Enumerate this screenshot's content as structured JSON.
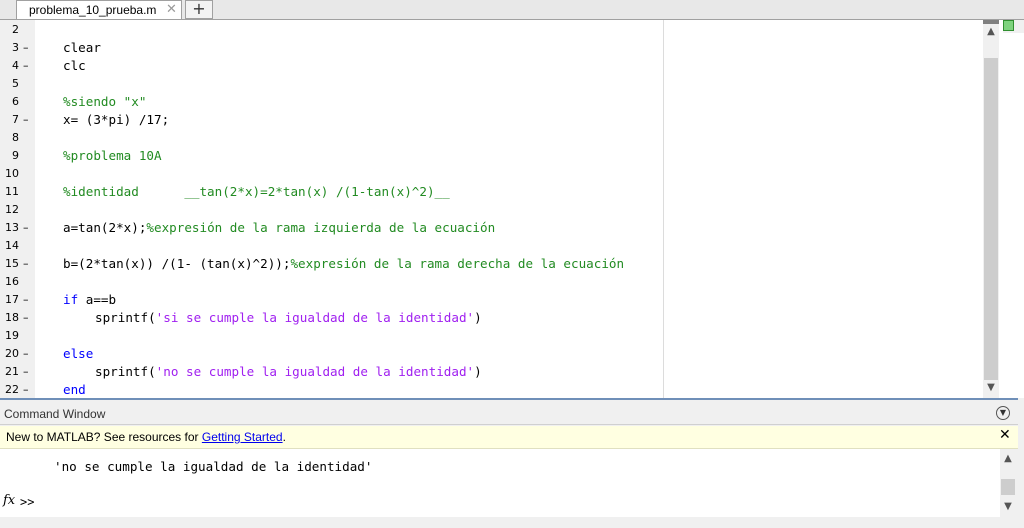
{
  "tab": {
    "title": "problema_10_prueba.m",
    "close": "✕",
    "add": "+"
  },
  "editor": {
    "lines": [
      {
        "n": "2",
        "dash": false,
        "indent": false,
        "parts": []
      },
      {
        "n": "3",
        "dash": true,
        "indent": false,
        "parts": [
          {
            "t": "clear",
            "c": "tx"
          }
        ]
      },
      {
        "n": "4",
        "dash": true,
        "indent": false,
        "parts": [
          {
            "t": "clc",
            "c": "tx"
          }
        ]
      },
      {
        "n": "5",
        "dash": false,
        "indent": false,
        "parts": []
      },
      {
        "n": "6",
        "dash": false,
        "indent": false,
        "parts": [
          {
            "t": "%siendo \"x\"",
            "c": "cm"
          }
        ]
      },
      {
        "n": "7",
        "dash": true,
        "indent": false,
        "parts": [
          {
            "t": "x= (3*pi) /17;",
            "c": "tx"
          }
        ]
      },
      {
        "n": "8",
        "dash": false,
        "indent": false,
        "parts": []
      },
      {
        "n": "9",
        "dash": false,
        "indent": false,
        "parts": [
          {
            "t": "%problema 10A",
            "c": "cm"
          }
        ]
      },
      {
        "n": "10",
        "dash": false,
        "indent": false,
        "parts": []
      },
      {
        "n": "11",
        "dash": false,
        "indent": false,
        "parts": [
          {
            "t": "%identidad      __tan(2*x)=2*tan(x) /(1-tan(x)^2)__",
            "c": "cm"
          }
        ]
      },
      {
        "n": "12",
        "dash": false,
        "indent": false,
        "parts": []
      },
      {
        "n": "13",
        "dash": true,
        "indent": false,
        "parts": [
          {
            "t": "a=tan(2*x);",
            "c": "tx"
          },
          {
            "t": "%expresión de la rama izquierda de la ecuación",
            "c": "cm"
          }
        ]
      },
      {
        "n": "14",
        "dash": false,
        "indent": false,
        "parts": []
      },
      {
        "n": "15",
        "dash": true,
        "indent": false,
        "parts": [
          {
            "t": "b=(2*tan(x)) /(1- (tan(x)^2));",
            "c": "tx"
          },
          {
            "t": "%expresión de la rama derecha de la ecuación",
            "c": "cm"
          }
        ]
      },
      {
        "n": "16",
        "dash": false,
        "indent": false,
        "parts": []
      },
      {
        "n": "17",
        "dash": true,
        "indent": false,
        "parts": [
          {
            "t": "if",
            "c": "kw"
          },
          {
            "t": " a==b",
            "c": "tx"
          }
        ]
      },
      {
        "n": "18",
        "dash": true,
        "indent": true,
        "parts": [
          {
            "t": "sprintf(",
            "c": "tx"
          },
          {
            "t": "'si se cumple la igualdad de la identidad'",
            "c": "st"
          },
          {
            "t": ")",
            "c": "tx"
          }
        ]
      },
      {
        "n": "19",
        "dash": false,
        "indent": false,
        "parts": []
      },
      {
        "n": "20",
        "dash": true,
        "indent": false,
        "parts": [
          {
            "t": "else",
            "c": "kw"
          }
        ]
      },
      {
        "n": "21",
        "dash": true,
        "indent": true,
        "parts": [
          {
            "t": "sprintf(",
            "c": "tx"
          },
          {
            "t": "'no se cumple la igualdad de la identidad'",
            "c": "st"
          },
          {
            "t": ")",
            "c": "tx"
          }
        ]
      },
      {
        "n": "22",
        "dash": true,
        "indent": false,
        "parts": [
          {
            "t": "end",
            "c": "kw"
          }
        ]
      }
    ]
  },
  "scroll": {
    "up": "▲",
    "down": "▼"
  },
  "command_window": {
    "title": "Command Window",
    "menu": "▼",
    "banner": {
      "prefix": "New to MATLAB? See resources for ",
      "link": "Getting Started",
      "suffix": ".",
      "close": "✕"
    },
    "output": "'no se cumple la igualdad de la identidad'",
    "fx": "fx",
    "prompt": ">>"
  },
  "colors": {
    "keyword": "#0000ff",
    "comment": "#228b22",
    "string": "#a020f0",
    "banner": "#ffffe1"
  }
}
